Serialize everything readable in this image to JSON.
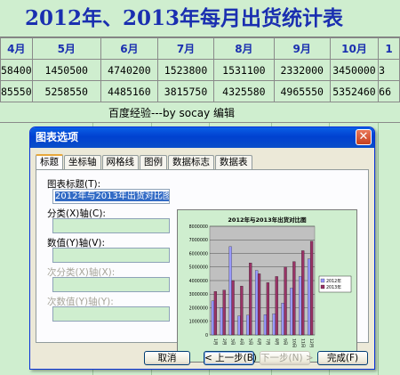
{
  "sheet": {
    "title": "2012年、2013年每月出货统计表",
    "months": [
      "4月",
      "5月",
      "6月",
      "7月",
      "8月",
      "9月",
      "10月",
      "1"
    ],
    "rows": [
      [
        "58400",
        "1450500",
        "4740200",
        "1523800",
        "1531100",
        "2332000",
        "3450000",
        "3"
      ],
      [
        "85550",
        "5258550",
        "4485160",
        "3815750",
        "4325580",
        "4965550",
        "5352460",
        "66"
      ]
    ],
    "credit": "百度经验---by socay 编辑"
  },
  "dialog": {
    "title": "图表选项",
    "close_glyph": "✕",
    "tabs": [
      "标题",
      "坐标轴",
      "网格线",
      "图例",
      "数据标志",
      "数据表"
    ],
    "fields": {
      "chart_title": {
        "label": "图表标题(T):",
        "value": "2012年与2013年出货对比图"
      },
      "category_x": {
        "label": "分类(X)轴(C):",
        "value": ""
      },
      "value_y": {
        "label": "数值(Y)轴(V):",
        "value": ""
      },
      "second_x": {
        "label": "次分类(X)轴(X):",
        "value": ""
      },
      "second_y": {
        "label": "次数值(Y)轴(Y):",
        "value": ""
      }
    },
    "buttons": {
      "cancel": "取消",
      "back": "< 上一步(B)",
      "next": "下一步(N) >",
      "finish": "完成(F)"
    }
  },
  "chart_data": {
    "type": "bar",
    "title": "2012年与2013年出货对比图",
    "categories": [
      "1月",
      "2月",
      "3月",
      "4月",
      "5月",
      "6月",
      "7月",
      "8月",
      "9月",
      "10月",
      "11月",
      "12月"
    ],
    "ylim": [
      0,
      8000000
    ],
    "yticks": [
      "0",
      "1000000",
      "2000000",
      "3000000",
      "4000000",
      "5000000",
      "6000000",
      "7000000",
      "8000000"
    ],
    "series": [
      {
        "name": "2012年",
        "color": "#9999ff",
        "values": [
          2500000,
          2000000,
          6500000,
          1400000,
          1450000,
          4750000,
          1500000,
          1550000,
          2350000,
          3450000,
          4300000,
          5600000
        ]
      },
      {
        "name": "2013年",
        "color": "#993366",
        "values": [
          3200000,
          3300000,
          4000000,
          3600000,
          5300000,
          4500000,
          3850000,
          4300000,
          5000000,
          5400000,
          6200000,
          6900000
        ]
      }
    ],
    "legend": "right",
    "plot_bg": "#c0c0c0"
  }
}
